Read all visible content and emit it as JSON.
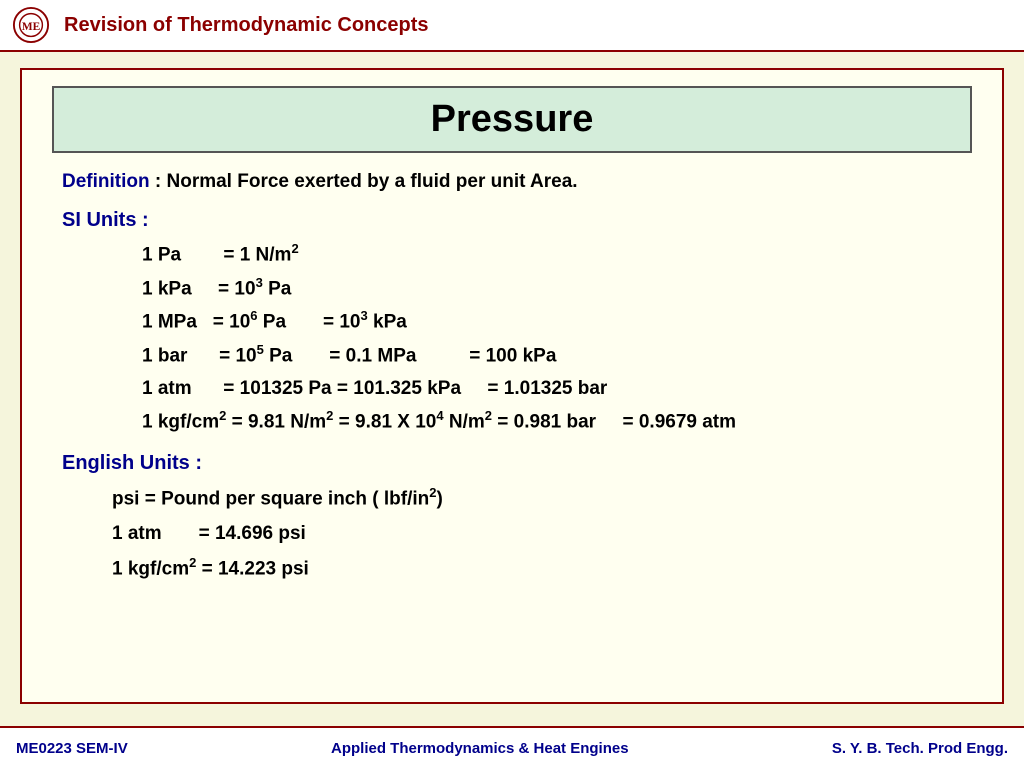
{
  "header": {
    "title": "Revision of Thermodynamic Concepts"
  },
  "main": {
    "title": "Pressure",
    "definition_label": "Definition",
    "definition_text": " : Normal Force exerted by a fluid per unit Area.",
    "si_label": "SI Units :",
    "si_rows": [
      {
        "left": "1 Pa",
        "right": "= 1 N/m²"
      },
      {
        "left": "1 kPa",
        "right": "= 10³ Pa"
      },
      {
        "left": "1 MPa",
        "right": "= 10⁶ Pa      =  10³ kPa"
      },
      {
        "left": "1 bar",
        "right": "= 10⁵ Pa      =  0.1 MPa         =  100 kPa"
      },
      {
        "left": "1 atm",
        "right": "= 101325 Pa  = 101.325 kPa     =  1.01325 bar"
      },
      {
        "left": "1 kgf/cm²",
        "right": "= 9.81 N/m²  = 9.81 X 10⁴ N/m²  = 0.981 bar     = 0.9679 atm"
      }
    ],
    "english_label": "English Units :",
    "english_rows": [
      "psi = Pound per square inch ( lbf/in²)",
      "1 atm       = 14.696 psi",
      "1 kgf/cm² = 14.223 psi"
    ]
  },
  "footer": {
    "left": "ME0223 SEM-IV",
    "center": "Applied Thermodynamics & Heat Engines",
    "right": "S. Y. B. Tech. Prod Engg."
  }
}
